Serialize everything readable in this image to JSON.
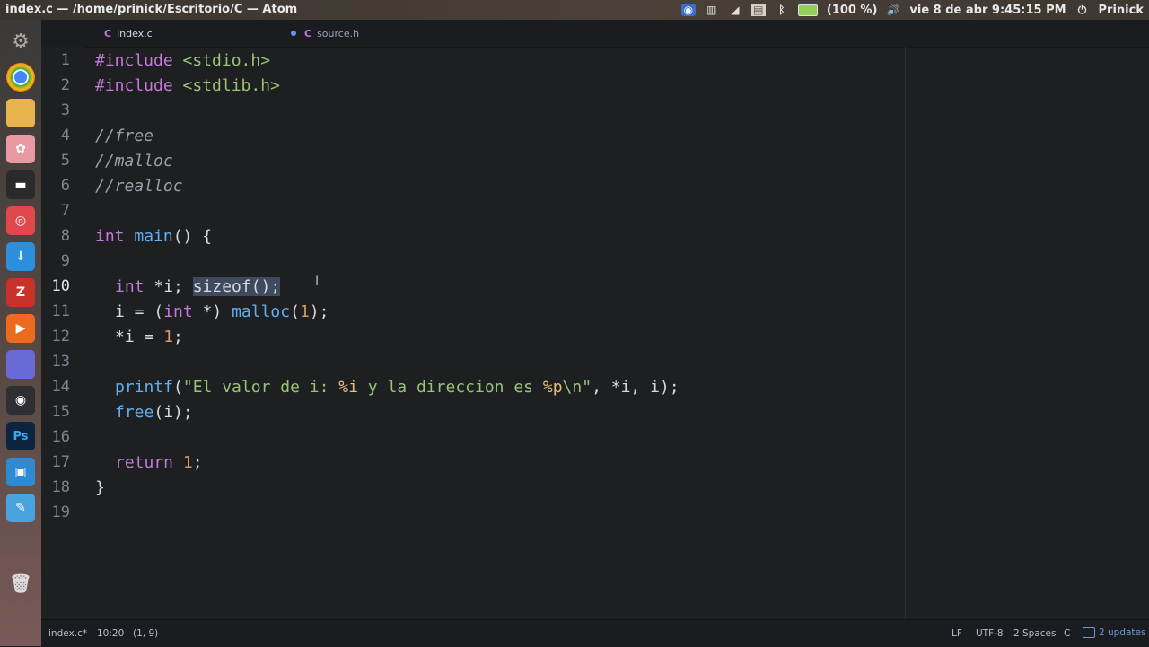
{
  "window": {
    "title": "index.c — /home/prinick/Escritorio/C — Atom"
  },
  "system_tray": {
    "battery": "(100 %)",
    "datetime": "vie 8 de abr 9:45:15 PM",
    "user": "Prinick",
    "icons": [
      "camera-icon",
      "chart-icon",
      "wifi-icon",
      "window-icon",
      "bluetooth-icon",
      "battery-icon",
      "volume-icon",
      "power-icon"
    ]
  },
  "launcher": {
    "items": [
      "settings-icon",
      "chrome-icon",
      "files-icon",
      "pink-app-icon",
      "terminal-icon",
      "ubuntu-store-icon",
      "download-icon",
      "filezilla-icon",
      "media-player-icon",
      "workspace-icon",
      "steam-icon",
      "photoshop-icon",
      "screenshot-icon",
      "editor-icon",
      "trash-icon"
    ]
  },
  "tabs": [
    {
      "label": "index.c",
      "icon": "c-file-icon",
      "modified": true
    },
    {
      "label": "source.h",
      "icon": "c-file-icon",
      "modified": false
    }
  ],
  "editor": {
    "line_numbers": [
      "1",
      "2",
      "3",
      "4",
      "5",
      "6",
      "7",
      "8",
      "9",
      "10",
      "11",
      "12",
      "13",
      "14",
      "15",
      "16",
      "17",
      "18",
      "19"
    ],
    "active_line": "10",
    "lines": {
      "l1": {
        "kw": "#include",
        "rest": " <stdio.h>"
      },
      "l2": {
        "kw": "#include",
        "rest": " <stdlib.h>"
      },
      "l4": "//free",
      "l5": "//malloc",
      "l6": "//realloc",
      "l8": {
        "kw": "int",
        "fn": "main",
        "rest": "() {"
      },
      "l10": {
        "kw": "int",
        "rest": " *i; ",
        "sel": "sizeof();"
      },
      "l11": {
        "a": "i = (",
        "kw": "int",
        "b": " *) ",
        "fn": "malloc",
        "c": "(",
        "num": "1",
        "d": ");"
      },
      "l12": {
        "a": "*i = ",
        "num": "1",
        "b": ";"
      },
      "l14": {
        "fn": "printf",
        "a": "(",
        "s1": "\"El valor de i: ",
        "f1": "%i",
        "s2": " y la direccion es ",
        "f2": "%p",
        "s3": "\\n\"",
        "b": ", *i, i);"
      },
      "l15": {
        "fn": "free",
        "a": "(i);"
      },
      "l17": {
        "kw": "return",
        "sp": " ",
        "num": "1",
        "b": ";"
      },
      "l18": "}"
    }
  },
  "status_bar": {
    "file": "index.c*",
    "position": "10:20",
    "selection": "(1, 9)",
    "line_ending": "LF",
    "encoding": "UTF-8",
    "indent": "2 Spaces",
    "grammar": "C",
    "updates": "2 updates"
  }
}
